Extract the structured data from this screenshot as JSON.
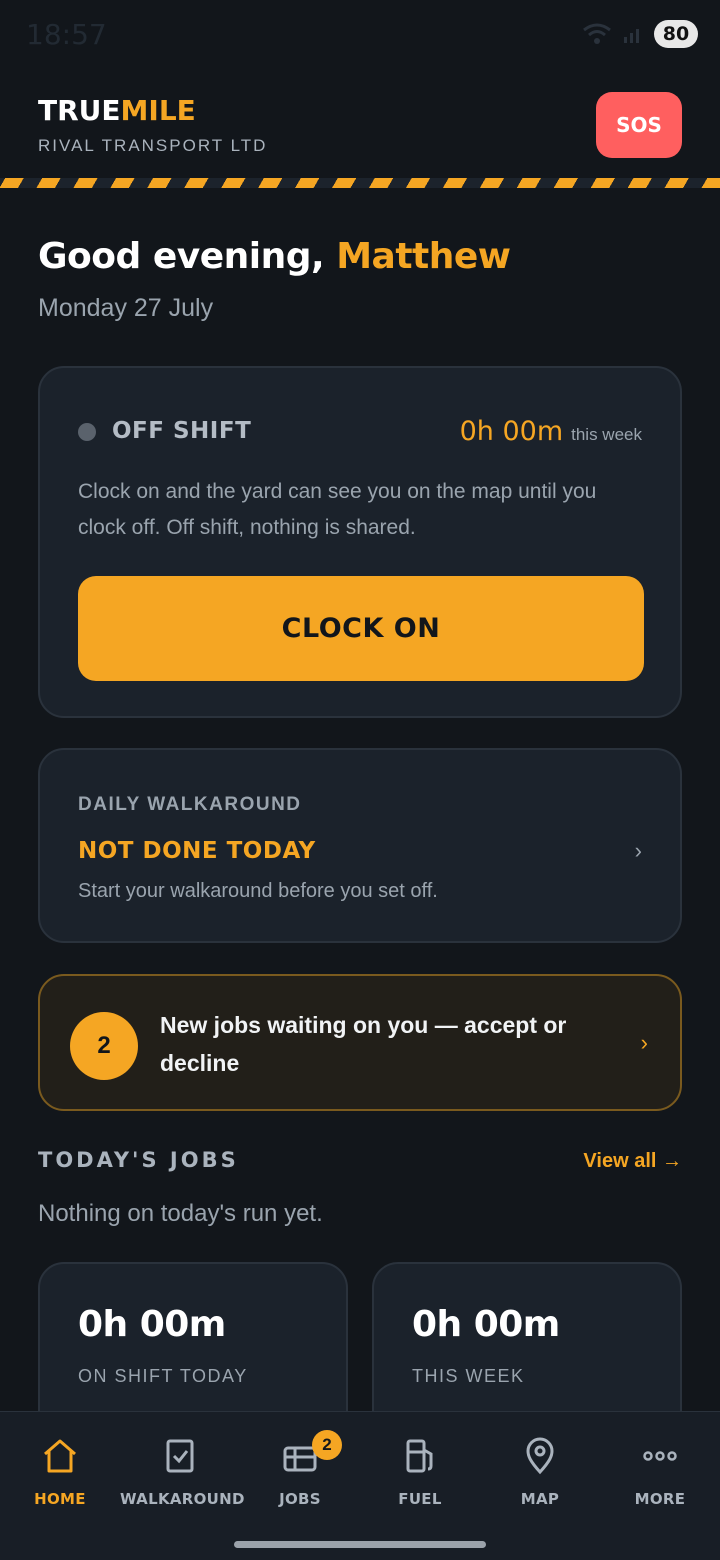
{
  "status_bar": {
    "time": "18:57",
    "battery": "80"
  },
  "header": {
    "brand_part1": "TRUE",
    "brand_part2": "MILE",
    "company": "RIVAL TRANSPORT LTD",
    "sos_label": "SOS"
  },
  "greeting": {
    "prefix": "Good evening, ",
    "name": "Matthew",
    "date": "Monday 27 July"
  },
  "shift": {
    "status": "OFF SHIFT",
    "hours_value": "0h 00m",
    "hours_label": "this week",
    "description": "Clock on and the yard can see you on the map until you clock off. Off shift, nothing is shared.",
    "button_label": "CLOCK ON"
  },
  "walkaround": {
    "title": "DAILY WALKAROUND",
    "status": "NOT DONE TODAY",
    "description": "Start your walkaround before you set off."
  },
  "jobs_banner": {
    "count": "2",
    "text": "New jobs waiting on you — accept or decline"
  },
  "todays_jobs": {
    "title": "TODAY'S JOBS",
    "view_all": "View all →",
    "empty_text": "Nothing on today's run yet."
  },
  "stats": [
    {
      "value": "0h 00m",
      "label": "ON SHIFT TODAY"
    },
    {
      "value": "0h 00m",
      "label": "THIS WEEK"
    }
  ],
  "tabs": [
    {
      "label": "HOME",
      "icon": "home-icon",
      "active": true
    },
    {
      "label": "WALKAROUND",
      "icon": "checklist-icon"
    },
    {
      "label": "JOBS",
      "icon": "jobs-icon",
      "badge": "2"
    },
    {
      "label": "FUEL",
      "icon": "fuel-pump-icon"
    },
    {
      "label": "MAP",
      "icon": "map-pin-icon"
    },
    {
      "label": "MORE",
      "icon": "more-dots-icon"
    }
  ],
  "colors": {
    "accent": "#f5a623",
    "background": "#12161b",
    "card": "#1b222b",
    "sos": "#ff5f5f"
  }
}
